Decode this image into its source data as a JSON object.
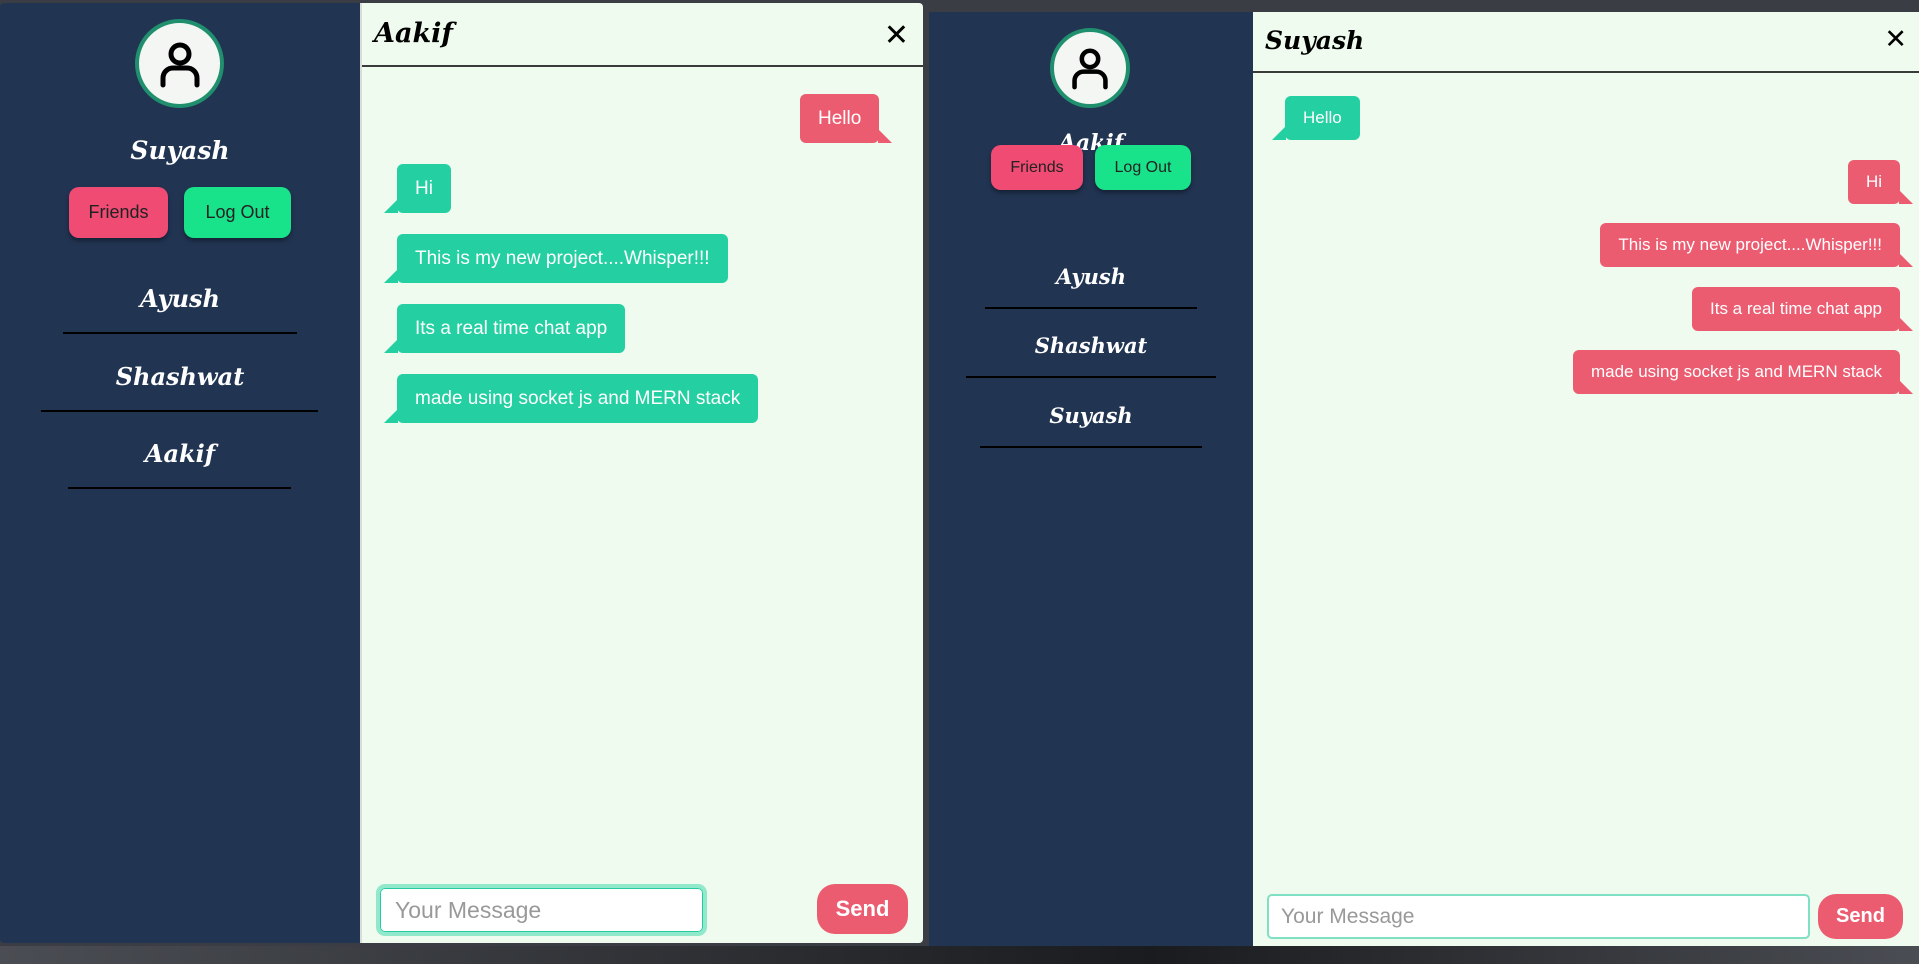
{
  "colors": {
    "sidebar_bg": "#213452",
    "chat_bg": "#eefbee",
    "incoming_bubble": "#24cfa2",
    "outgoing_bubble": "#ec5c71",
    "friends_button": "#ef4b73",
    "logout_button": "#19e38a"
  },
  "left_window": {
    "sidebar": {
      "avatar_icon": "user-icon",
      "user_name": "Suyash",
      "friends_label": "Friends",
      "logout_label": "Log Out",
      "friends": [
        {
          "name": "Ayush"
        },
        {
          "name": "Shashwat"
        },
        {
          "name": "Aakif"
        }
      ]
    },
    "chat": {
      "title": "Aakif",
      "close_icon": "close-icon",
      "messages": [
        {
          "text": "Hello",
          "direction": "outgoing"
        },
        {
          "text": "Hi",
          "direction": "incoming"
        },
        {
          "text": "This is my new project....Whisper!!!",
          "direction": "incoming"
        },
        {
          "text": "Its a real time chat app",
          "direction": "incoming"
        },
        {
          "text": "made using socket js and MERN stack",
          "direction": "incoming"
        }
      ],
      "input_placeholder": "Your Message",
      "input_value": "",
      "send_label": "Send"
    }
  },
  "right_window": {
    "sidebar": {
      "avatar_icon": "user-icon",
      "user_name": "Aakif",
      "friends_label": "Friends",
      "logout_label": "Log Out",
      "friends": [
        {
          "name": "Ayush"
        },
        {
          "name": "Shashwat"
        },
        {
          "name": "Suyash"
        }
      ]
    },
    "chat": {
      "title": "Suyash",
      "close_icon": "close-icon",
      "messages": [
        {
          "text": "Hello",
          "direction": "incoming"
        },
        {
          "text": "Hi",
          "direction": "outgoing"
        },
        {
          "text": "This is my new project....Whisper!!!",
          "direction": "outgoing"
        },
        {
          "text": "Its a real time chat app",
          "direction": "outgoing"
        },
        {
          "text": "made using socket js and MERN stack",
          "direction": "outgoing"
        }
      ],
      "input_placeholder": "Your Message",
      "input_value": "",
      "send_label": "Send"
    }
  }
}
